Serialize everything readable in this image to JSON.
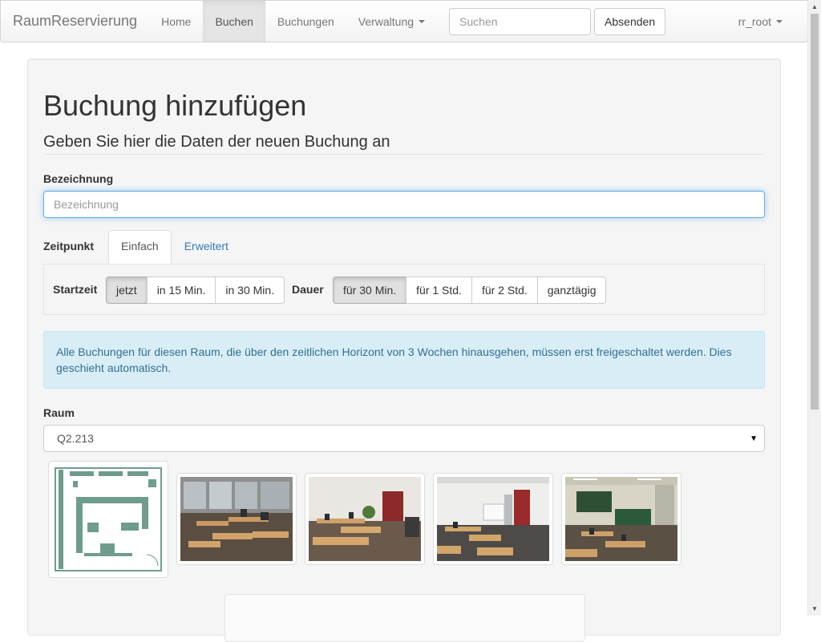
{
  "navbar": {
    "brand": "RaumReservierung",
    "items": [
      {
        "label": "Home",
        "active": false
      },
      {
        "label": "Buchen",
        "active": true
      },
      {
        "label": "Buchungen",
        "active": false
      },
      {
        "label": "Verwaltung",
        "active": false,
        "dropdown": true
      }
    ],
    "search_placeholder": "Suchen",
    "search_button": "Absenden",
    "user": "rr_root"
  },
  "main": {
    "title": "Buchung hinzufügen",
    "subtitle": "Geben Sie hier die Daten der neuen Buchung an",
    "name_label": "Bezeichnung",
    "name_placeholder": "Bezeichnung",
    "time_label": "Zeitpunkt",
    "tabs": [
      {
        "label": "Einfach",
        "active": true
      },
      {
        "label": "Erweitert",
        "active": false
      }
    ],
    "start_label": "Startzeit",
    "start_options": [
      {
        "label": "jetzt",
        "active": true
      },
      {
        "label": "in 15 Min.",
        "active": false
      },
      {
        "label": "in 30 Min.",
        "active": false
      }
    ],
    "duration_label": "Dauer",
    "duration_options": [
      {
        "label": "für 30 Min.",
        "active": true
      },
      {
        "label": "für 1 Std.",
        "active": false
      },
      {
        "label": "für 2 Std.",
        "active": false
      },
      {
        "label": "ganztägig",
        "active": false
      }
    ],
    "info_text": "Alle Buchungen für diesen Raum, die über den zeitlichen Horizont von 3 Wochen hinausgehen, müssen erst freigeschaltet werden. Dies geschieht automatisch.",
    "room_label": "Raum",
    "room_selected": "Q2.213"
  },
  "colors": {
    "link": "#337ab7",
    "info_bg": "#d9edf7",
    "info_text": "#31708f",
    "focus_border": "#66afe9"
  }
}
